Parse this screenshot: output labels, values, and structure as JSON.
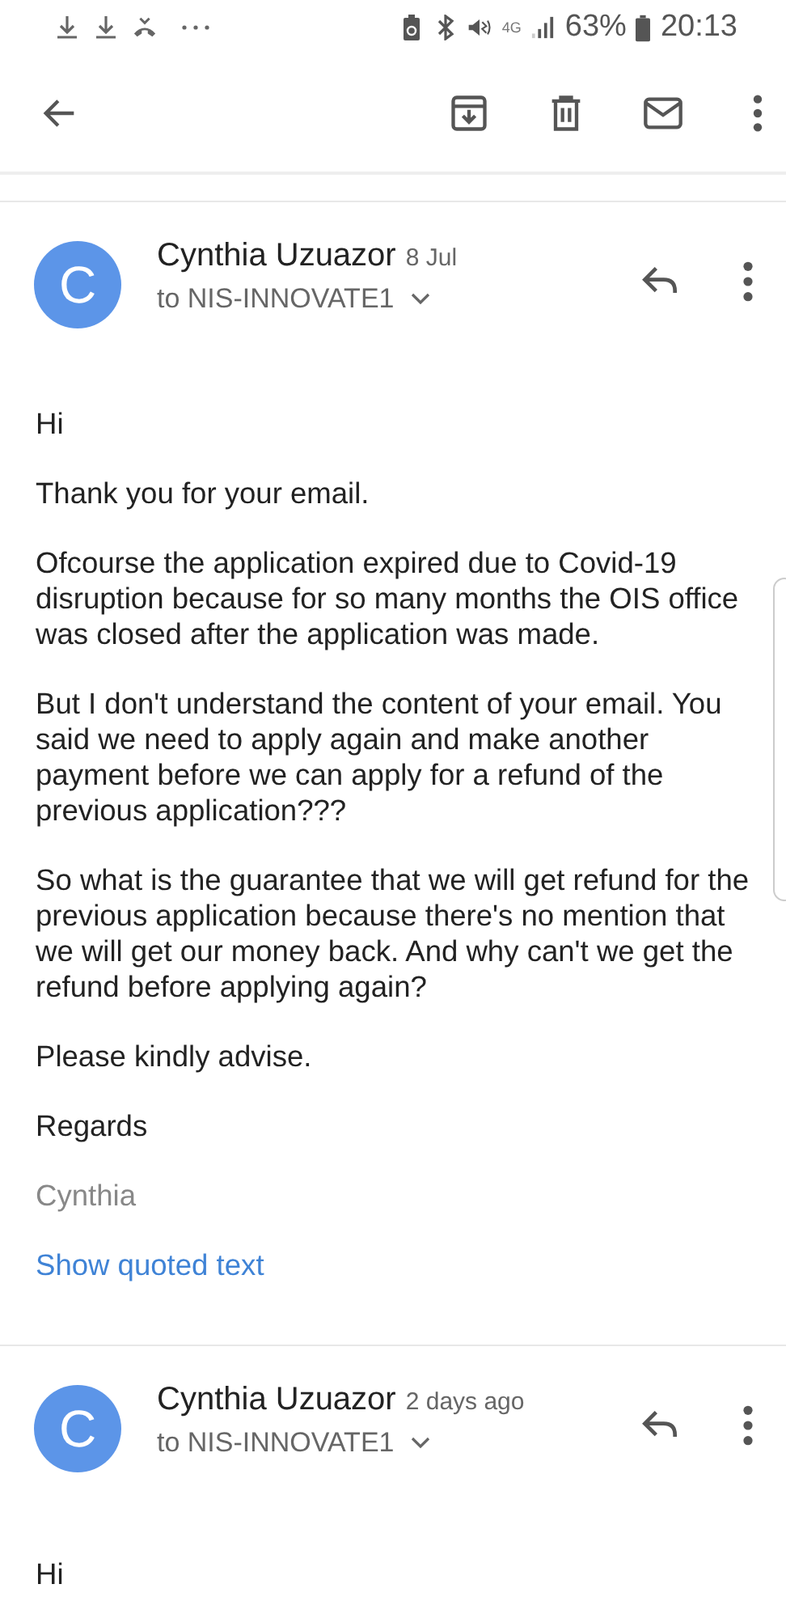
{
  "status_bar": {
    "network": "4G",
    "battery": "63%",
    "time": "20:13"
  },
  "messages": [
    {
      "avatar": "C",
      "sender": "Cynthia Uzuazor",
      "date": "8 Jul",
      "recipient": "to NIS-INNOVATE1",
      "expanded": false,
      "body": [
        {
          "kind": "text",
          "text": "Hi"
        },
        {
          "kind": "text",
          "text": "Thank you for your email."
        },
        {
          "kind": "text",
          "text": "Ofcourse the application expired due to Covid-19 disruption because for so many months the OIS office was closed after the application was made."
        },
        {
          "kind": "text",
          "text": "But I don't understand the content of your email. You said we need to apply again and make another payment before we can apply for a refund of the previous application???"
        },
        {
          "kind": "text",
          "text": "So what is the guarantee that we will get refund for the previous application because there's no mention that we will get our money back. And why can't we get the refund before applying again?"
        },
        {
          "kind": "text",
          "text": "Please kindly advise."
        },
        {
          "kind": "text",
          "text": "Regards"
        },
        {
          "kind": "signature",
          "text": "Cynthia"
        },
        {
          "kind": "link",
          "text": "Show quoted text"
        }
      ]
    },
    {
      "avatar": "C",
      "sender": "Cynthia Uzuazor",
      "date": "2 days ago",
      "recipient": "to NIS-INNOVATE1",
      "expanded": false,
      "body": [
        {
          "kind": "text",
          "text": "Hi"
        }
      ]
    }
  ]
}
